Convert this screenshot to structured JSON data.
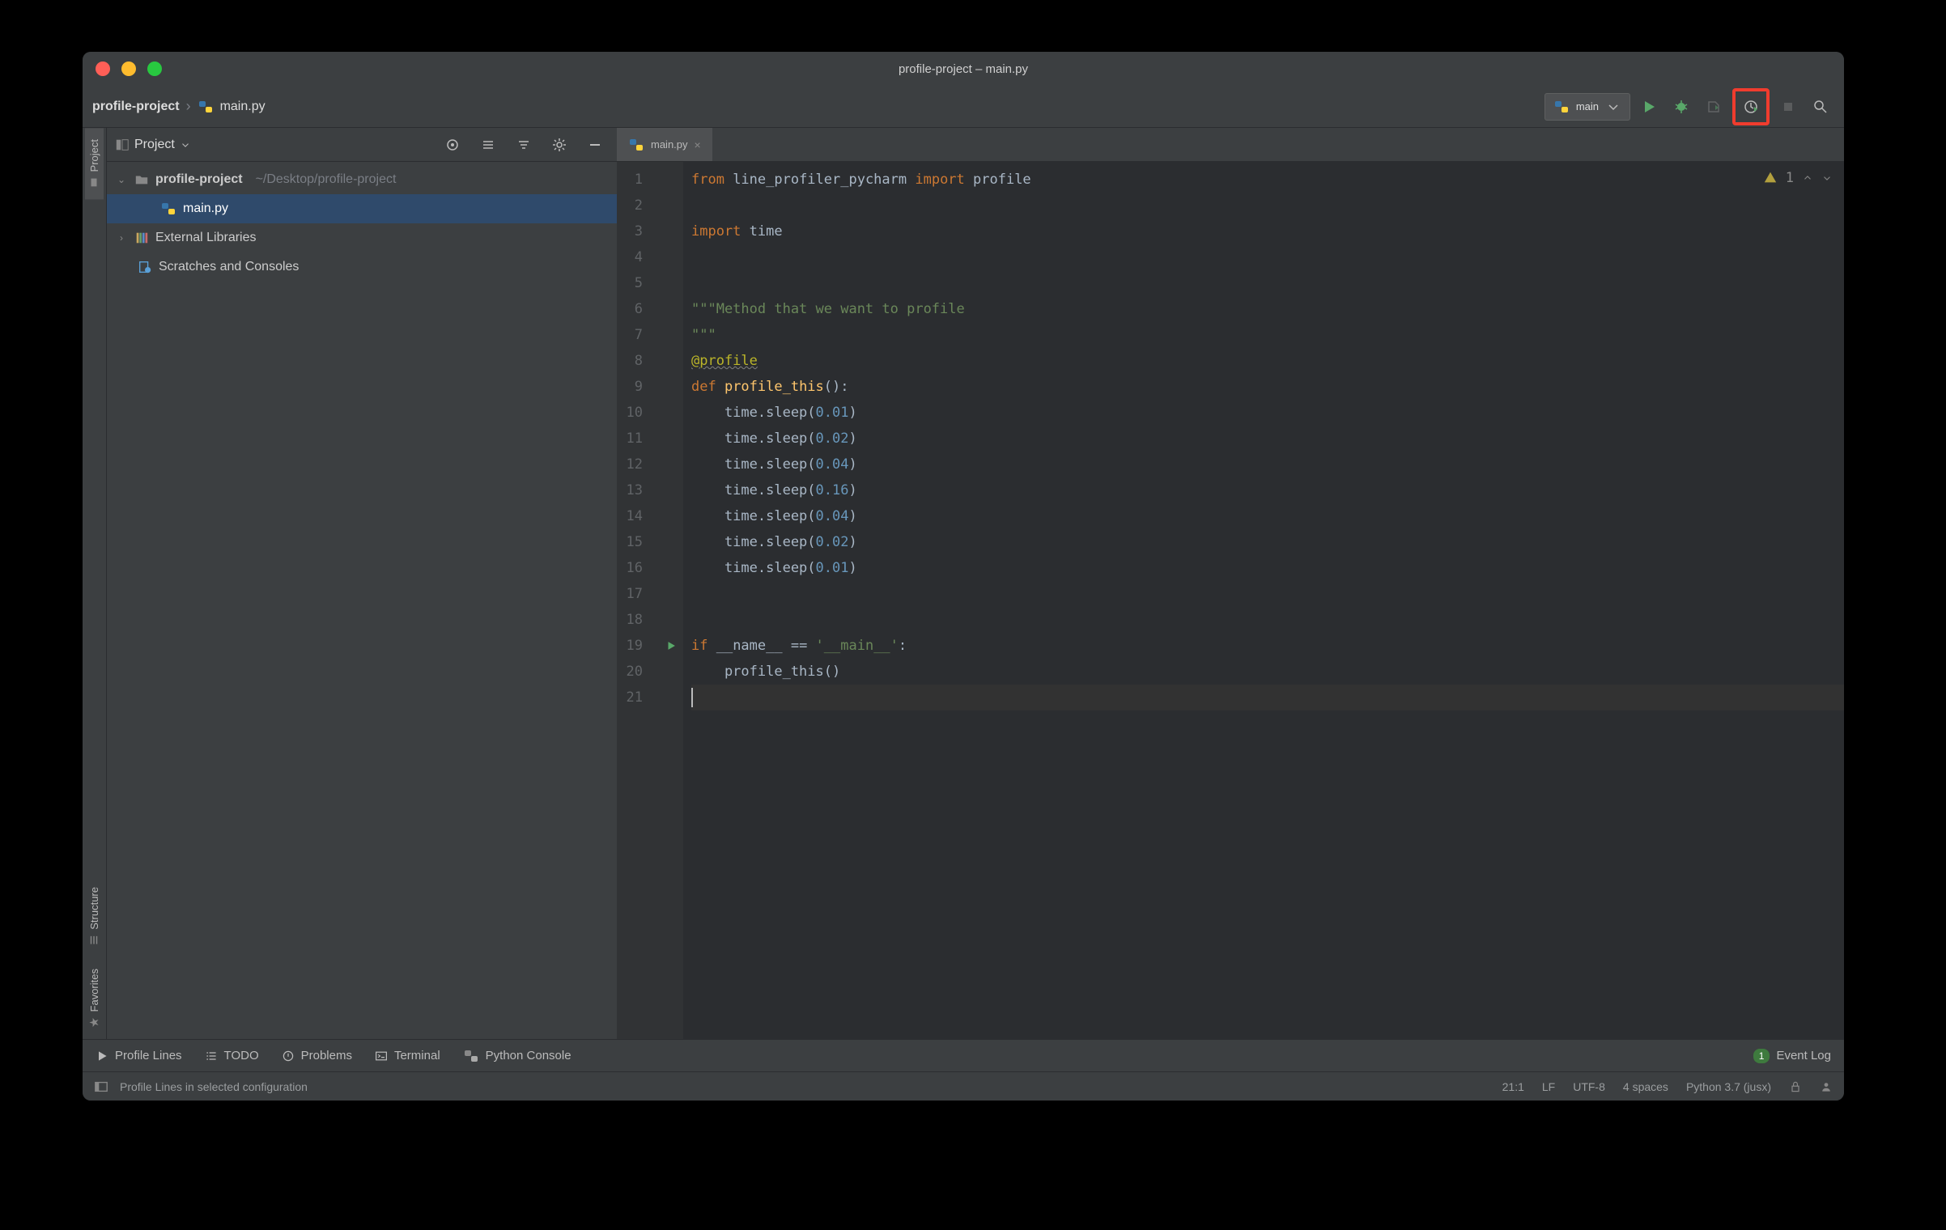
{
  "title": "profile-project – main.py",
  "breadcrumbs": {
    "project": "profile-project",
    "file": "main.py"
  },
  "runConfig": {
    "name": "main"
  },
  "warnings": {
    "count": "1"
  },
  "highlight": {
    "color": "#f03c2e"
  },
  "projectPanel": {
    "title": "Project",
    "root": {
      "name": "profile-project",
      "path": "~/Desktop/profile-project"
    },
    "file": "main.py",
    "externalLibs": "External Libraries",
    "scratches": "Scratches and Consoles"
  },
  "editor": {
    "tab": "main.py",
    "lines": [
      {
        "n": 1,
        "tokens": [
          [
            "kw",
            "from"
          ],
          [
            "id",
            " line_profiler_pycharm "
          ],
          [
            "kw",
            "import"
          ],
          [
            "id",
            " profile"
          ]
        ]
      },
      {
        "n": 2,
        "tokens": [
          [
            "id",
            ""
          ]
        ]
      },
      {
        "n": 3,
        "tokens": [
          [
            "kw",
            "import"
          ],
          [
            "id",
            " time"
          ]
        ]
      },
      {
        "n": 4,
        "tokens": [
          [
            "id",
            ""
          ]
        ]
      },
      {
        "n": 5,
        "tokens": [
          [
            "id",
            ""
          ]
        ]
      },
      {
        "n": 6,
        "tokens": [
          [
            "str",
            "\"\"\"Method that we want to profile"
          ]
        ]
      },
      {
        "n": 7,
        "tokens": [
          [
            "str",
            "\"\"\""
          ]
        ]
      },
      {
        "n": 8,
        "tokens": [
          [
            "decor",
            "@profile"
          ]
        ],
        "wavy": true
      },
      {
        "n": 9,
        "tokens": [
          [
            "kw",
            "def "
          ],
          [
            "func",
            "profile_this"
          ],
          [
            "id",
            "():"
          ]
        ]
      },
      {
        "n": 10,
        "tokens": [
          [
            "id",
            "    time.sleep("
          ],
          [
            "num",
            "0.01"
          ],
          [
            "id",
            ")"
          ]
        ]
      },
      {
        "n": 11,
        "tokens": [
          [
            "id",
            "    time.sleep("
          ],
          [
            "num",
            "0.02"
          ],
          [
            "id",
            ")"
          ]
        ]
      },
      {
        "n": 12,
        "tokens": [
          [
            "id",
            "    time.sleep("
          ],
          [
            "num",
            "0.04"
          ],
          [
            "id",
            ")"
          ]
        ]
      },
      {
        "n": 13,
        "tokens": [
          [
            "id",
            "    time.sleep("
          ],
          [
            "num",
            "0.16"
          ],
          [
            "id",
            ")"
          ]
        ]
      },
      {
        "n": 14,
        "tokens": [
          [
            "id",
            "    time.sleep("
          ],
          [
            "num",
            "0.04"
          ],
          [
            "id",
            ")"
          ]
        ]
      },
      {
        "n": 15,
        "tokens": [
          [
            "id",
            "    time.sleep("
          ],
          [
            "num",
            "0.02"
          ],
          [
            "id",
            ")"
          ]
        ]
      },
      {
        "n": 16,
        "tokens": [
          [
            "id",
            "    time.sleep("
          ],
          [
            "num",
            "0.01"
          ],
          [
            "id",
            ")"
          ]
        ]
      },
      {
        "n": 17,
        "tokens": [
          [
            "id",
            ""
          ]
        ]
      },
      {
        "n": 18,
        "tokens": [
          [
            "id",
            ""
          ]
        ]
      },
      {
        "n": 19,
        "tokens": [
          [
            "kw",
            "if"
          ],
          [
            "id",
            " __name__ == "
          ],
          [
            "str",
            "'__main__'"
          ],
          [
            "id",
            ":"
          ]
        ],
        "runMarker": true
      },
      {
        "n": 20,
        "tokens": [
          [
            "id",
            "    profile_this()"
          ]
        ]
      },
      {
        "n": 21,
        "tokens": [
          [
            "id",
            ""
          ]
        ],
        "cursor": true
      }
    ]
  },
  "bottomBar": {
    "profileLines": "Profile Lines",
    "todo": "TODO",
    "problems": "Problems",
    "terminal": "Terminal",
    "pythonConsole": "Python Console",
    "eventLog": "Event Log"
  },
  "statusBar": {
    "message": "Profile Lines in selected configuration",
    "pos": "21:1",
    "lineSep": "LF",
    "encoding": "UTF-8",
    "indent": "4 spaces",
    "interpreter": "Python 3.7 (jusx)"
  },
  "leftRail": {
    "project": "Project",
    "structure": "Structure",
    "favorites": "Favorites"
  }
}
